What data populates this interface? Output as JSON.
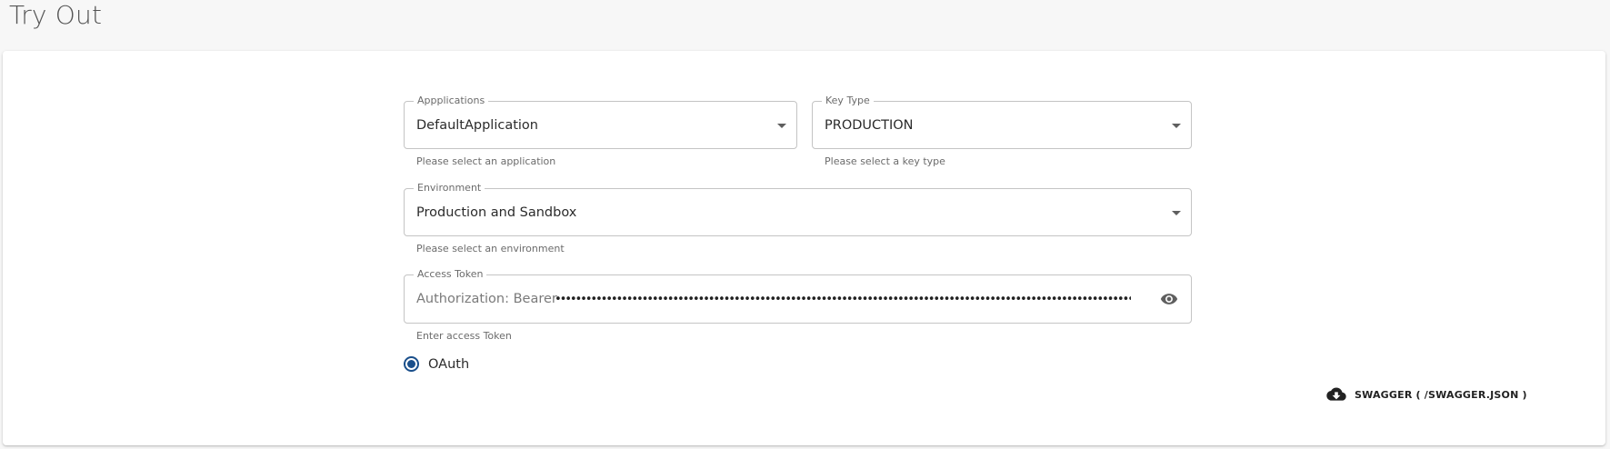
{
  "page": {
    "title": "Try Out"
  },
  "form": {
    "application": {
      "label": "Appplications",
      "value": "DefaultApplication",
      "helper": "Please select an application"
    },
    "key_type": {
      "label": "Key Type",
      "value": "PRODUCTION",
      "helper": "Please select a key type"
    },
    "environment": {
      "label": "Environment",
      "value": "Production and Sandbox",
      "helper": "Please select an environment"
    },
    "access_token": {
      "label": "Access Token",
      "prefix": "Authorization: Bearer",
      "masked_value": "••••••••••••••••••••••••••••••••••••••••••••••••••••••••••••••••••••••••••••••••••••••••••••••••••••••••••••••••••••••••••••••••••••••••••••••••••••••••••••••••••",
      "helper": "Enter access Token",
      "visibility_icon": "eye-icon"
    },
    "auth_option": {
      "label": "OAuth",
      "selected": true
    }
  },
  "download": {
    "label": "SWAGGER ( /SWAGGER.JSON )",
    "icon": "cloud-download-icon"
  },
  "colors": {
    "accent": "#1a4f8b",
    "border": "#c4c4c4",
    "background": "#f7f7f7",
    "card": "#ffffff"
  }
}
